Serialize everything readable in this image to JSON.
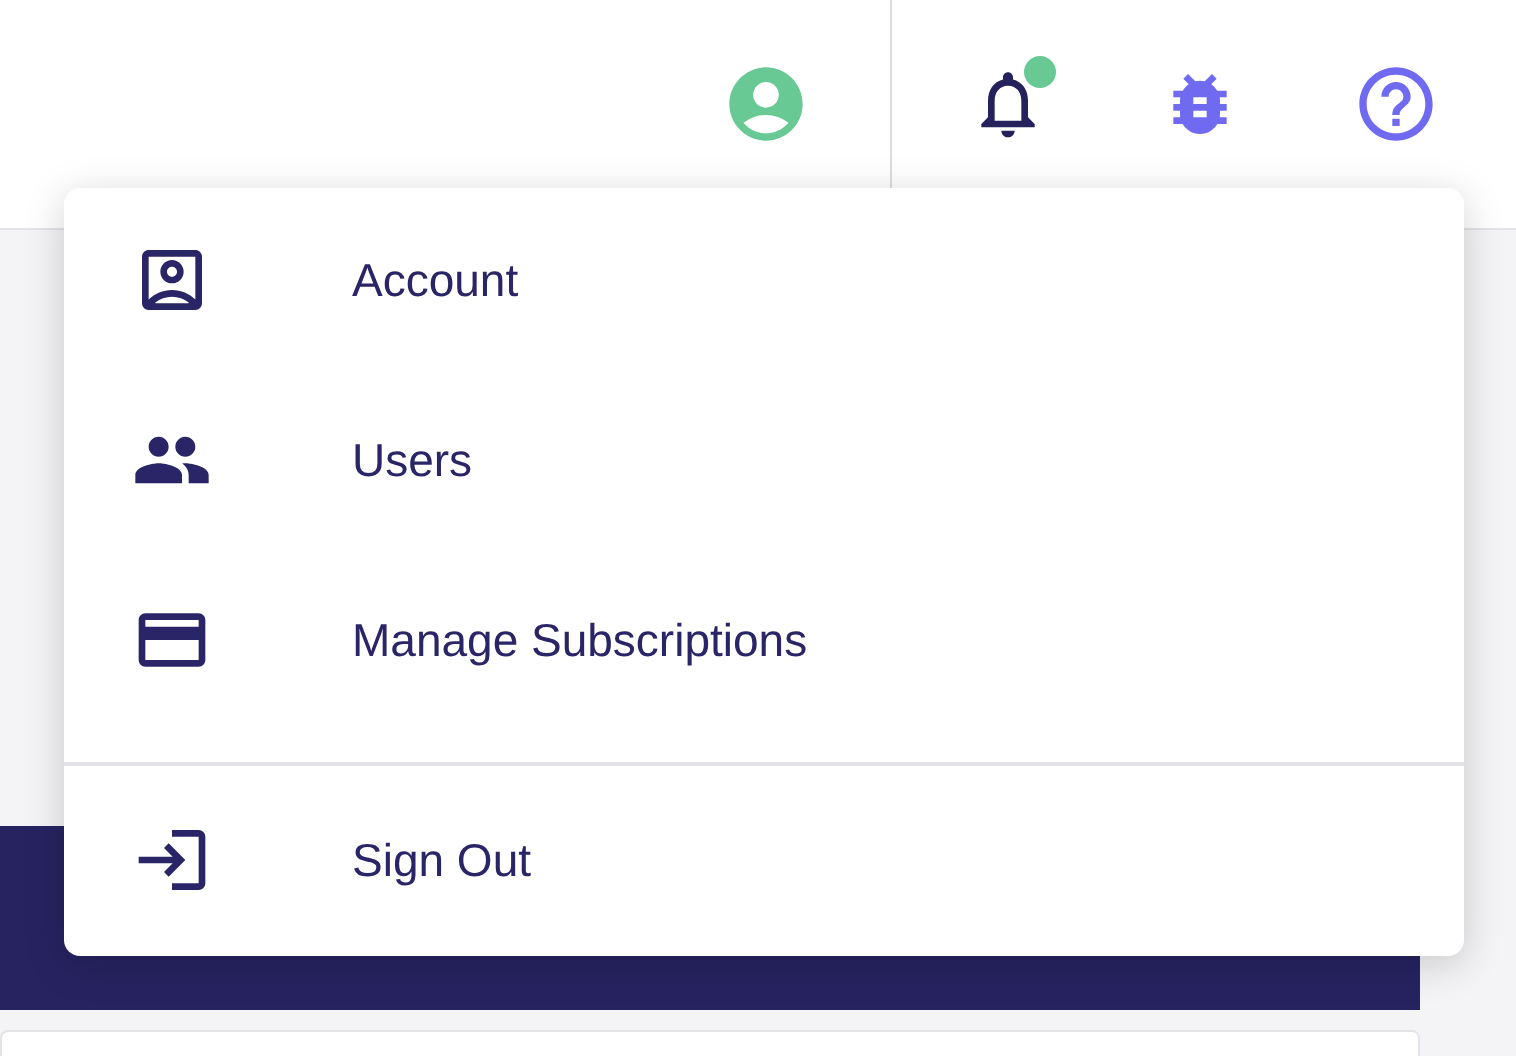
{
  "header": {
    "notifications": {
      "unread": true
    }
  },
  "menu": {
    "sections": [
      [
        {
          "kind": "account",
          "label": "Account"
        },
        {
          "kind": "users",
          "label": "Users"
        },
        {
          "kind": "card",
          "label": "Manage Subscriptions"
        }
      ],
      [
        {
          "kind": "signout",
          "label": "Sign Out"
        }
      ]
    ]
  }
}
